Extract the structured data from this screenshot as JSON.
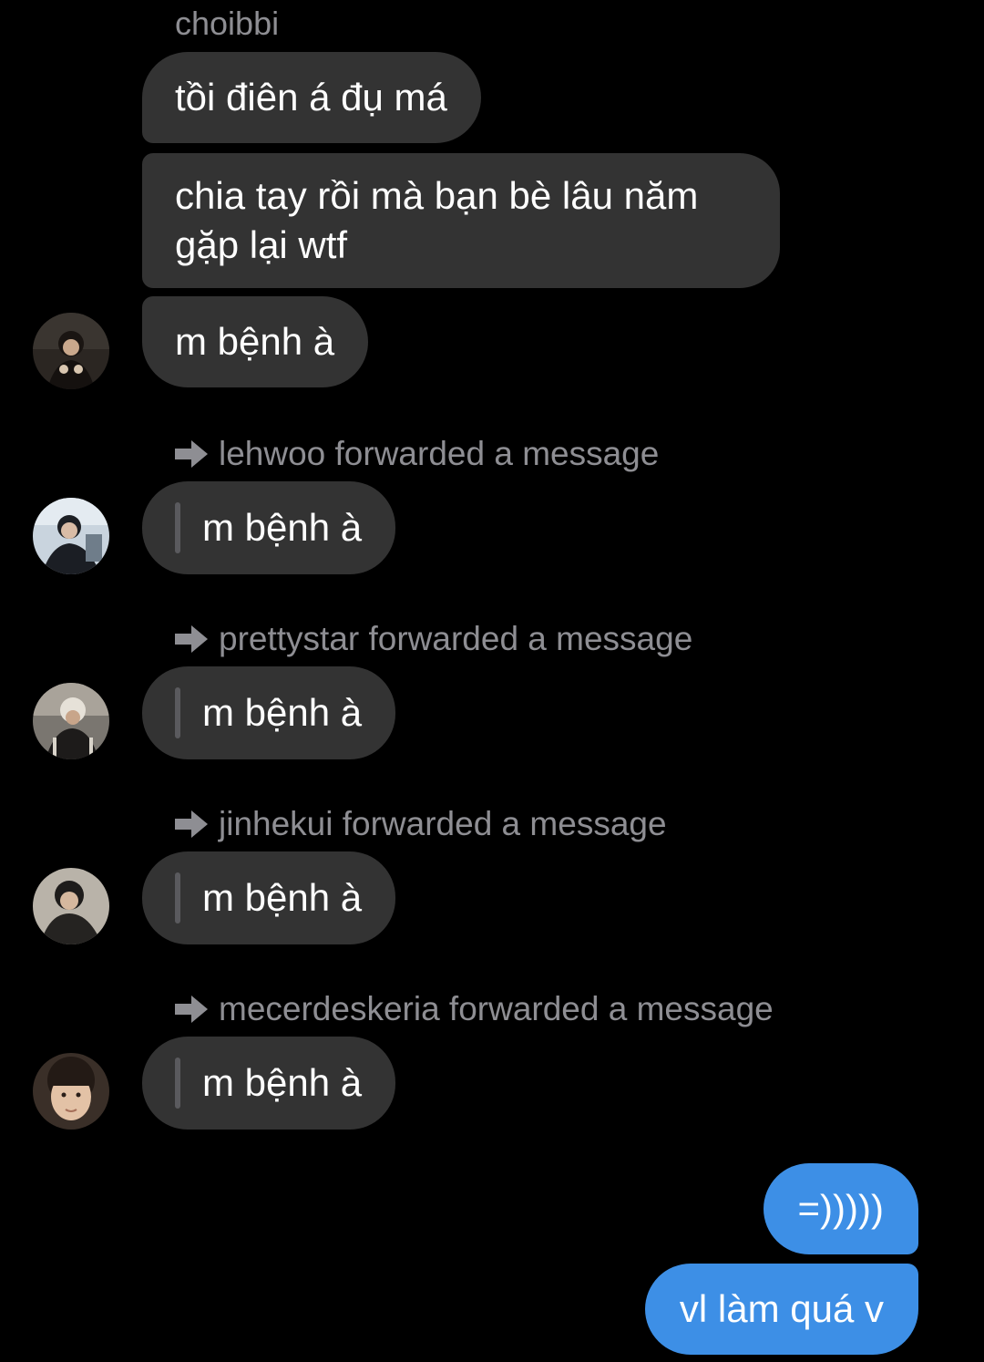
{
  "thread": {
    "sender_name": "choibbi",
    "messages": [
      {
        "text": "tồi điên á đụ má"
      },
      {
        "text": "chia tay rồi mà bạn bè lâu năm gặp lại wtf"
      },
      {
        "text": "m bệnh à"
      }
    ],
    "forwards": [
      {
        "label": "lehwoo forwarded a message",
        "text": "m bệnh à"
      },
      {
        "label": "prettystar forwarded a message",
        "text": "m bệnh à"
      },
      {
        "label": "jinhekui forwarded a message",
        "text": "m bệnh à"
      },
      {
        "label": "mecerdeskeria forwarded a message",
        "text": "m bệnh à"
      }
    ],
    "outgoing": [
      {
        "text": "=)))))"
      },
      {
        "text": "vl làm quá v"
      }
    ]
  },
  "colors": {
    "background": "#000000",
    "incoming_bubble": "#333333",
    "outgoing_bubble": "#3d8fe6",
    "meta_text": "#8e8e93"
  },
  "icons": {
    "forward": "forward-arrow-icon",
    "avatar": "user-avatar"
  }
}
